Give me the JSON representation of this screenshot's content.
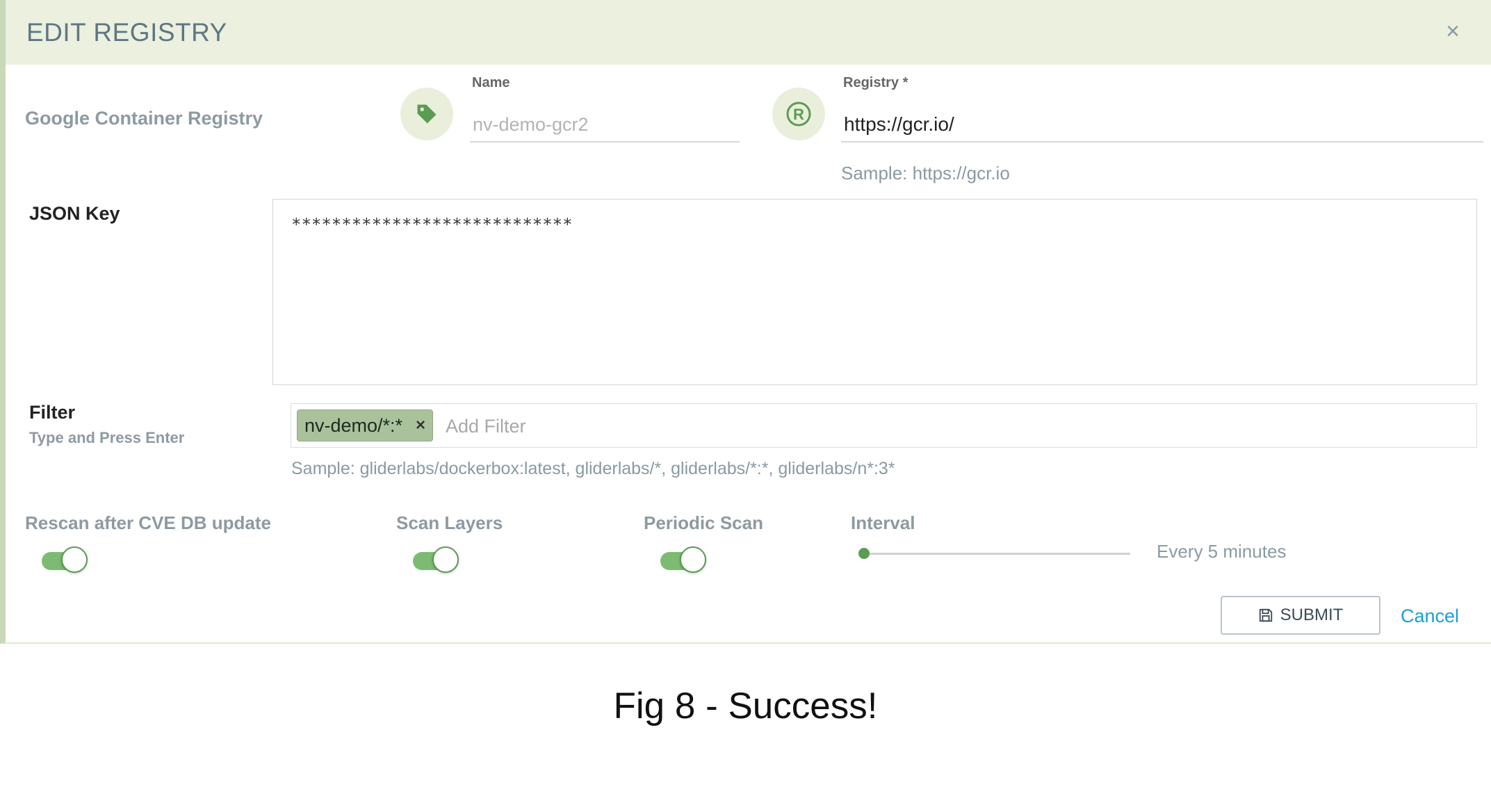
{
  "dialog": {
    "title": "EDIT REGISTRY",
    "close_label": "×",
    "registry_type": "Google Container Registry",
    "name": {
      "label": "Name",
      "placeholder": "nv-demo-gcr2"
    },
    "registry": {
      "label": "Registry *",
      "value": "https://gcr.io/",
      "sample": "Sample: https://gcr.io"
    },
    "json_key": {
      "label": "JSON Key",
      "value": "****************************"
    },
    "filter": {
      "label": "Filter",
      "sublabel": "Type and Press Enter",
      "chips": [
        "nv-demo/*:*"
      ],
      "chip_remove": "×",
      "placeholder": "Add Filter",
      "sample": "Sample: gliderlabs/dockerbox:latest, gliderlabs/*, gliderlabs/*:*, gliderlabs/n*:3*"
    },
    "toggles": {
      "rescan": {
        "label": "Rescan after CVE DB update",
        "on": true
      },
      "scan_layers": {
        "label": "Scan Layers",
        "on": true
      },
      "periodic_scan": {
        "label": "Periodic Scan",
        "on": true
      }
    },
    "interval": {
      "label": "Interval",
      "value_text": "Every 5 minutes",
      "slider_fraction": 0.0
    },
    "submit_label": "SUBMIT",
    "cancel_label": "Cancel"
  },
  "caption": "Fig 8 - Success!",
  "colors": {
    "header_bg": "#ebf0df",
    "accent_green": "#5a9c52",
    "toggle_track": "#7dbb73",
    "link_blue": "#1a9fd5"
  },
  "icons": {
    "name_icon": "tag-icon",
    "registry_icon": "registered-icon",
    "submit_icon": "save-icon"
  }
}
